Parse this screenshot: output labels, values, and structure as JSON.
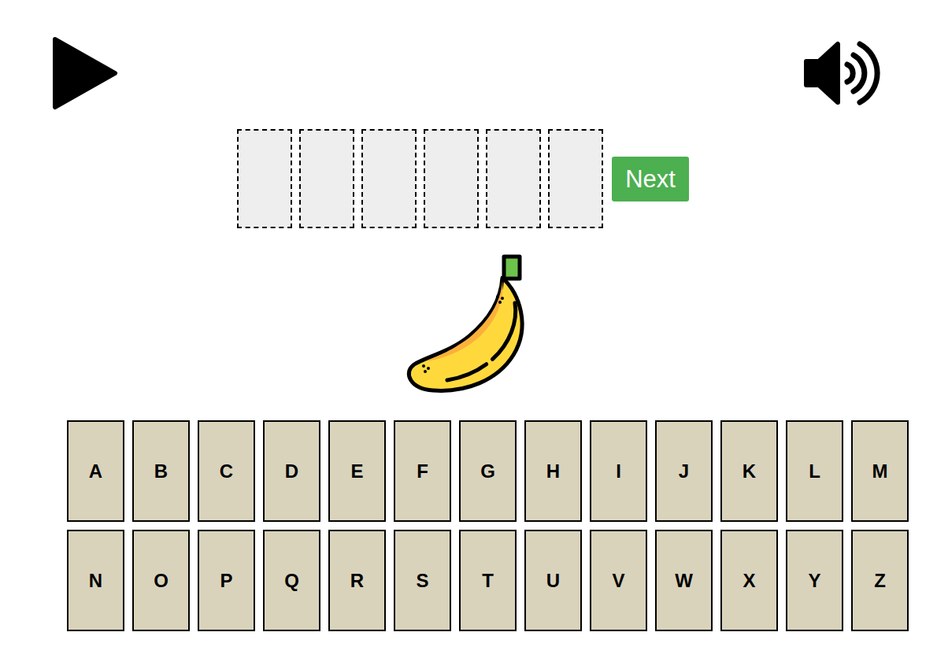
{
  "slots": [
    {
      "filled": false
    },
    {
      "filled": false
    },
    {
      "filled": false
    },
    {
      "filled": false
    },
    {
      "filled": false
    },
    {
      "filled": false
    }
  ],
  "next_button": {
    "label": "Next"
  },
  "keyboard": {
    "rows": [
      [
        "A",
        "B",
        "C",
        "D",
        "E",
        "F",
        "G",
        "H",
        "I",
        "J",
        "K",
        "L",
        "M"
      ],
      [
        "N",
        "O",
        "P",
        "Q",
        "R",
        "S",
        "T",
        "U",
        "V",
        "W",
        "X",
        "Y",
        "Z"
      ]
    ]
  }
}
